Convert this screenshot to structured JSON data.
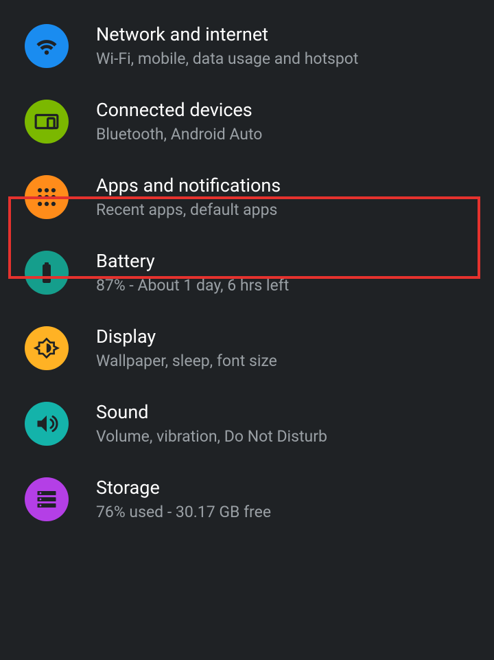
{
  "settings": {
    "items": [
      {
        "title": "Network and internet",
        "subtitle": "Wi-Fi, mobile, data usage and hotspot",
        "icon": "wifi-icon",
        "color": "c-blue"
      },
      {
        "title": "Connected devices",
        "subtitle": "Bluetooth, Android Auto",
        "icon": "devices-icon",
        "color": "c-green"
      },
      {
        "title": "Apps and notifications",
        "subtitle": "Recent apps, default apps",
        "icon": "apps-icon",
        "color": "c-orange"
      },
      {
        "title": "Battery",
        "subtitle": "87% - About 1 day, 6 hrs left",
        "icon": "battery-icon",
        "color": "c-teal"
      },
      {
        "title": "Display",
        "subtitle": "Wallpaper, sleep, font size",
        "icon": "brightness-icon",
        "color": "c-amber"
      },
      {
        "title": "Sound",
        "subtitle": "Volume, vibration, Do Not Disturb",
        "icon": "sound-icon",
        "color": "c-cyan"
      },
      {
        "title": "Storage",
        "subtitle": "76% used - 30.17 GB free",
        "icon": "storage-icon",
        "color": "c-purple"
      }
    ],
    "highlighted_index": 2
  }
}
